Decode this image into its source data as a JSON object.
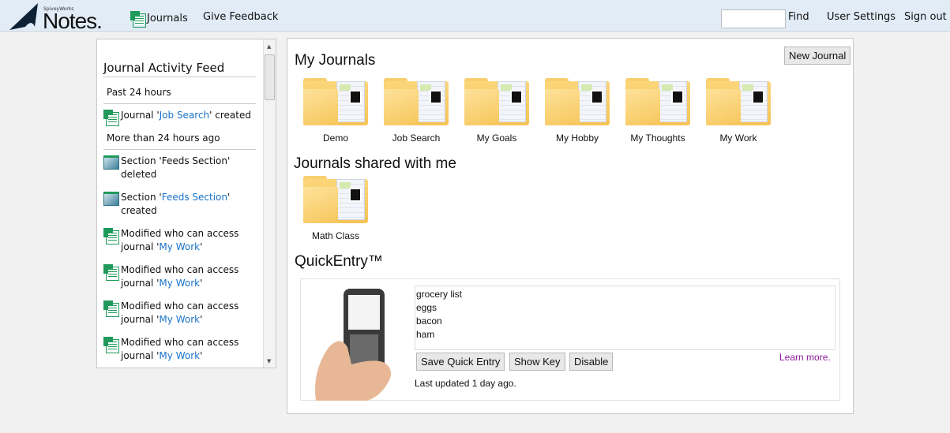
{
  "header": {
    "brand_small": "SpiveyWorks",
    "brand": "Notes.",
    "nav": [
      "Journals",
      "Give Feedback"
    ],
    "find_label": "Find",
    "find_value": "",
    "user_settings": "User Settings",
    "sign_out": "Sign out"
  },
  "feed": {
    "title": "Journal Activity Feed",
    "groups": [
      {
        "heading": "Past 24 hours"
      },
      {
        "heading": "More than 24 hours ago"
      }
    ],
    "items": [
      {
        "pre": "Journal '",
        "link": "Job Search",
        "post": "' created"
      },
      {
        "pre": "Section 'Feeds Section' deleted",
        "link": "",
        "post": ""
      },
      {
        "pre": "Section '",
        "link": "Feeds Section",
        "post": "' created"
      },
      {
        "pre": "Modified who can access journal '",
        "link": "My Work",
        "post": "'"
      },
      {
        "pre": "Modified who can access journal '",
        "link": "My Work",
        "post": "'"
      },
      {
        "pre": "Modified who can access journal '",
        "link": "My Work",
        "post": "'"
      },
      {
        "pre": "Modified who can access journal '",
        "link": "My Work",
        "post": "'"
      }
    ]
  },
  "main": {
    "my_journals_title": "My Journals",
    "new_journal": "New Journal",
    "journals": [
      "Demo",
      "Job Search",
      "My Goals",
      "My Hobby",
      "My Thoughts",
      "My Work"
    ],
    "shared_title": "Journals shared with me",
    "shared": [
      "Math Class"
    ],
    "quickentry": {
      "title": "QuickEntry™",
      "text": "grocery list\neggs\nbacon\nham",
      "learn_more": "Learn more.",
      "save": "Save Quick Entry",
      "show_key": "Show Key",
      "disable": "Disable",
      "updated": "Last updated 1 day ago."
    }
  }
}
